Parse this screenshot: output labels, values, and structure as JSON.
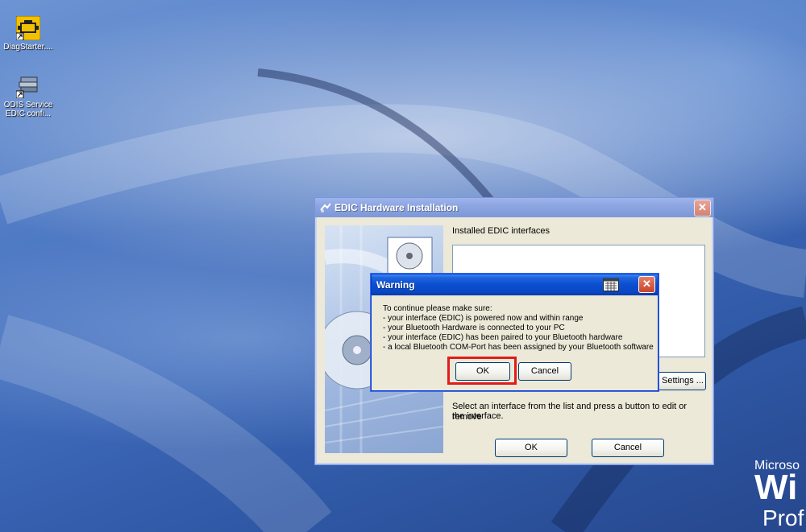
{
  "desktop": {
    "icons": [
      {
        "name": "diagstarter-icon",
        "label": "DiagStarter...."
      },
      {
        "name": "odis-service-icon",
        "label_line1": "ODIS Service",
        "label_line2": "EDIC confi..."
      }
    ],
    "windows_branding": {
      "line1": "Microso",
      "line2": "Wi",
      "line3": "Prof"
    }
  },
  "main_dialog": {
    "title": "EDIC Hardware Installation",
    "close_glyph": "✕",
    "installed_label": "Installed EDIC interfaces",
    "settings_button": "Settings ...",
    "instructions": [
      "Select an interface from the list and press a button to edit or remove",
      "the interface."
    ],
    "ok_button": "OK",
    "cancel_button": "Cancel"
  },
  "warning_dialog": {
    "title": "Warning",
    "close_glyph": "✕",
    "message_lines": [
      "To continue please make sure:",
      "- your interface (EDIC) is powered now and within range",
      "- your Bluetooth Hardware is connected to your PC",
      "- your interface (EDIC) has been paired to your Bluetooth hardware",
      "- a local Bluetooth COM-Port has been assigned by your Bluetooth software"
    ],
    "ok_button": "OK",
    "cancel_button": "Cancel",
    "highlight_color": "#e21b1b"
  }
}
